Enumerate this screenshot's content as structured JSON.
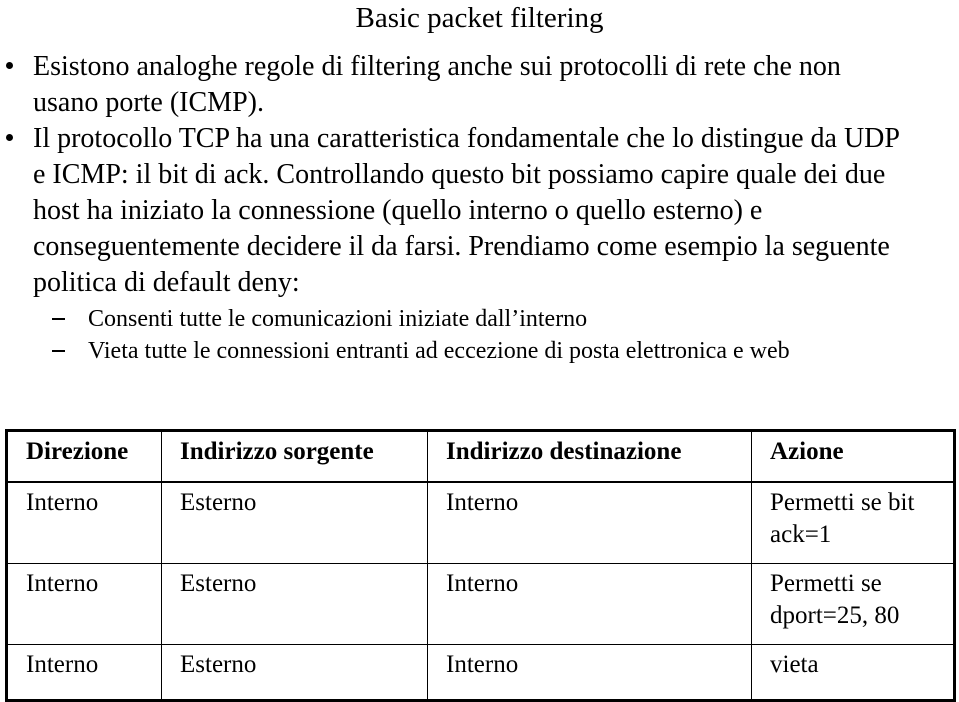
{
  "slide": {
    "title": "Basic packet filtering",
    "bullets": [
      {
        "marker": "dot",
        "lines": [
          "Esistono analoghe regole di filtering anche sui protocolli di rete che non",
          "usano porte (ICMP)."
        ]
      },
      {
        "marker": "dot",
        "lines": [
          "Il protocollo TCP ha una caratteristica fondamentale che lo distingue da UDP",
          "e ICMP: il bit di ack. Controllando questo bit possiamo capire quale dei due",
          "host ha iniziato la connessione (quello interno o quello esterno) e",
          "conseguentemente decidere il da farsi. Prendiamo come esempio la seguente",
          "politica di default deny:"
        ]
      }
    ],
    "sub_bullets": [
      {
        "marker": "dash",
        "text": "Consenti tutte le comunicazioni iniziate dall’interno"
      },
      {
        "marker": "dash",
        "text": "Vieta tutte le connessioni entranti ad eccezione di posta elettronica e web"
      }
    ],
    "table": {
      "headers": [
        "Direzione",
        "Indirizzo sorgente",
        "Indirizzo destinazione",
        "Azione"
      ],
      "rows": [
        {
          "direzione": "Interno",
          "sorgente": "Esterno",
          "destinazione": "Interno",
          "azione_line1": "Permetti se bit",
          "azione_line2": "ack=1"
        },
        {
          "direzione": "Interno",
          "sorgente": "Esterno",
          "destinazione": "Interno",
          "azione_line1": "Permetti se",
          "azione_line2": "dport=25, 80"
        },
        {
          "direzione": "Interno",
          "sorgente": "Esterno",
          "destinazione": "Interno",
          "azione_line1": "vieta",
          "azione_line2": ""
        }
      ]
    },
    "colors": {
      "text": "#000000",
      "background": "#ffffff",
      "table_border": "#000000"
    }
  }
}
